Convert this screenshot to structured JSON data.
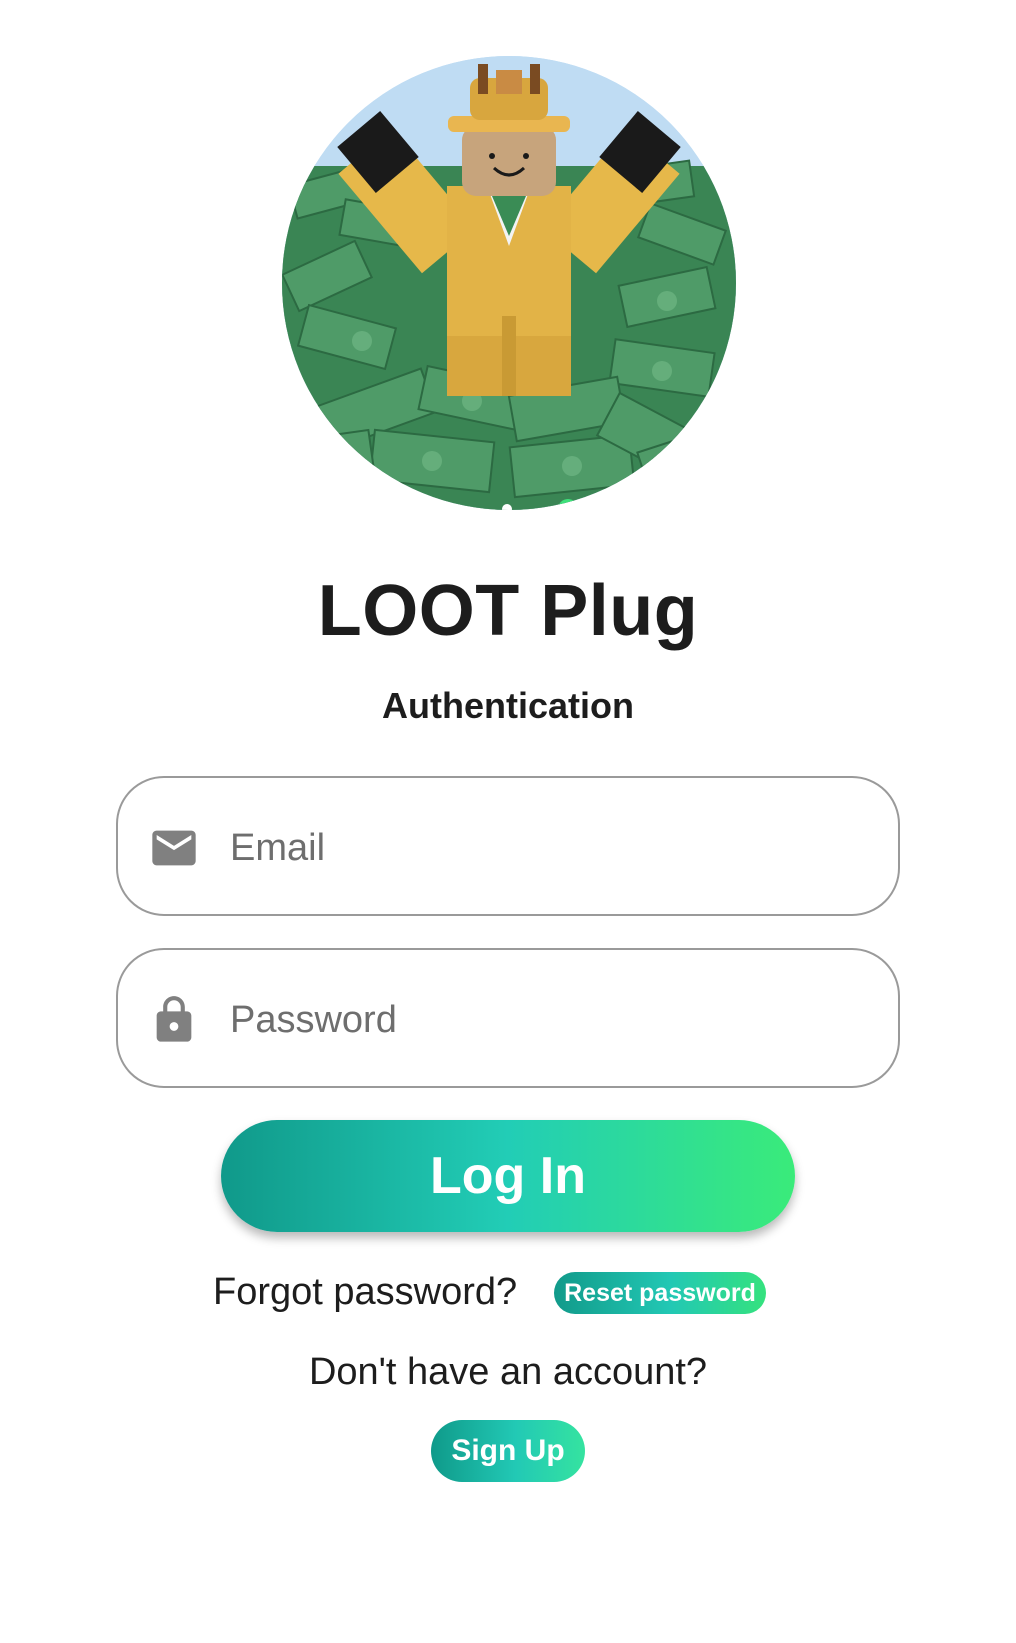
{
  "hero": {
    "image": "roblox-character-in-pile-of-cash",
    "carousel_pages": 3,
    "active_page": 3
  },
  "app": {
    "title": "LOOT Plug",
    "subtitle": "Authentication"
  },
  "form": {
    "email": {
      "placeholder": "Email",
      "value": "",
      "icon": "mail-icon"
    },
    "password": {
      "placeholder": "Password",
      "value": "",
      "icon": "lock-icon"
    },
    "login_label": "Log In"
  },
  "forgot": {
    "prompt": "Forgot password?",
    "reset_label": "Reset password"
  },
  "signup": {
    "prompt": "Don't have an account?",
    "button_label": "Sign Up"
  },
  "colors": {
    "accent_start": "#10998a",
    "accent_mid": "#22cdb6",
    "accent_end": "#3aeb7a",
    "active_dot": "#3ee07a",
    "border": "#9a9a9a",
    "text": "#1d1d1d"
  }
}
